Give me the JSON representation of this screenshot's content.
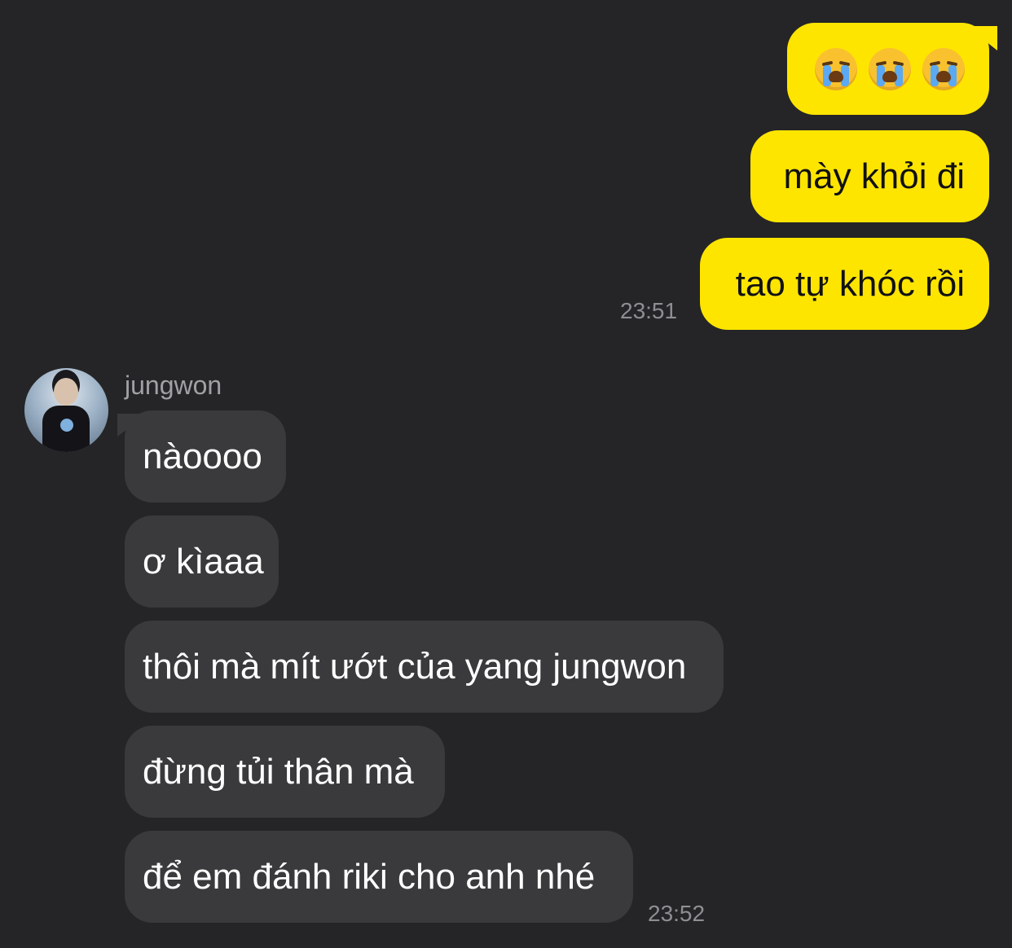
{
  "colors": {
    "background": "#252527",
    "outgoing_bubble": "#fee500",
    "incoming_bubble": "#3a3a3c",
    "timestamp": "#8e8e93"
  },
  "outgoing": {
    "emoji_message": [
      "loudly-crying-face-icon",
      "loudly-crying-face-icon",
      "loudly-crying-face-icon"
    ],
    "messages": [
      "mày khỏi đi",
      "tao tự khóc rồi"
    ],
    "time": "23:51"
  },
  "incoming": {
    "sender": "jungwon",
    "avatar_icon": "profile-photo-avatar",
    "messages": [
      "nàoooo",
      "ơ kìaaa",
      "thôi mà mít ướt của yang jungwon",
      "đừng tủi thân mà",
      "để em đánh riki cho anh nhé"
    ],
    "time": "23:52"
  }
}
